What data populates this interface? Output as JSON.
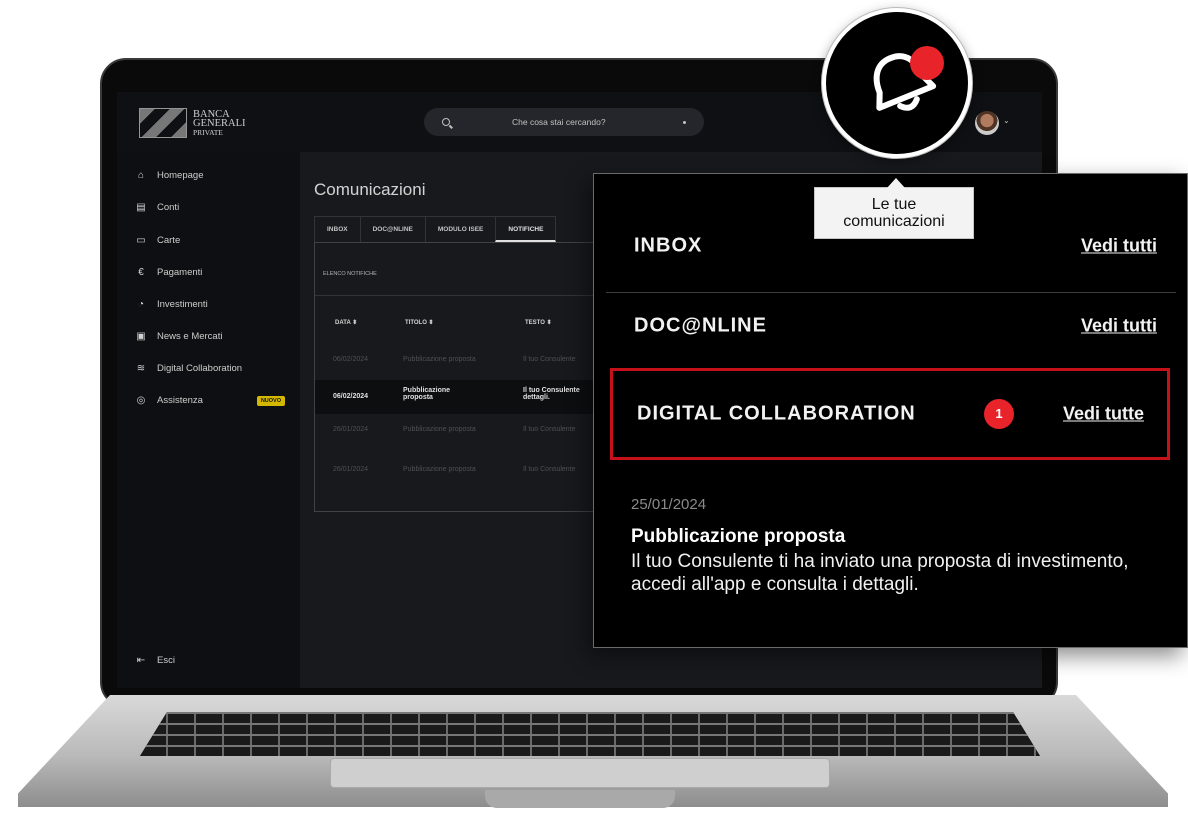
{
  "app": {
    "logo": {
      "line1": "BANCA",
      "line2": "GENERALI",
      "line3": "PRIVATE"
    },
    "search": {
      "placeholder": "Che cosa stai cercando?",
      "icon": "search-icon"
    },
    "avatar_caret": "⌄"
  },
  "sidebar": {
    "items": [
      {
        "label": "Homepage",
        "icon": "home-icon"
      },
      {
        "label": "Conti",
        "icon": "database-icon"
      },
      {
        "label": "Carte",
        "icon": "card-icon"
      },
      {
        "label": "Pagamenti",
        "icon": "euro-icon"
      },
      {
        "label": "Investimenti",
        "icon": "pie-chart-icon"
      },
      {
        "label": "News e Mercati",
        "icon": "news-icon"
      },
      {
        "label": "Digital Collaboration",
        "icon": "handshake-icon"
      },
      {
        "label": "Assistenza",
        "icon": "lifebuoy-icon",
        "badge": "NUOVO"
      }
    ],
    "logout": {
      "label": "Esci",
      "icon": "logout-icon"
    }
  },
  "main": {
    "title": "Comunicazioni",
    "tabs": [
      "INBOX",
      "DOC@NLINE",
      "MODULO ISEE",
      "NOTIFICHE"
    ],
    "active_tab": "NOTIFICHE",
    "list_label": "ELENCO NOTIFICHE",
    "columns": [
      "DATA",
      "TITOLO",
      "TESTO"
    ],
    "rows": [
      {
        "date": "06/02/2024",
        "title": "Pubblicazione proposta",
        "text": "Il tuo Consulente",
        "highlight": false
      },
      {
        "date": "06/02/2024",
        "title": "Pubblicazione proposta",
        "text": "Il tuo Consulente dettagli.",
        "highlight": true
      },
      {
        "date": "26/01/2024",
        "title": "Pubblicazione proposta",
        "text": "Il tuo Consulente",
        "highlight": false
      },
      {
        "date": "26/01/2024",
        "title": "Pubblicazione proposta",
        "text": "Il tuo Consulente",
        "highlight": false
      }
    ]
  },
  "overlay": {
    "bell_icon": "bell-icon",
    "tooltip_line1": "Le tue",
    "tooltip_line2": "comunicazioni",
    "sections": [
      {
        "title": "INBOX",
        "link": "Vedi tutti"
      },
      {
        "title": "DOC@NLINE",
        "link": "Vedi tutti"
      },
      {
        "title": "DIGITAL COLLABORATION",
        "link": "Vedi tutte",
        "count": "1"
      }
    ],
    "latest": {
      "date": "25/01/2024",
      "subject": "Pubblicazione proposta",
      "body": "Il tuo Consulente ti ha inviato una proposta di investimento, accedi all'app e consulta i dettagli."
    },
    "colors": {
      "accent_red": "#e8242a",
      "highlight_border": "#c4111a",
      "new_badge": "#f2d200"
    }
  }
}
